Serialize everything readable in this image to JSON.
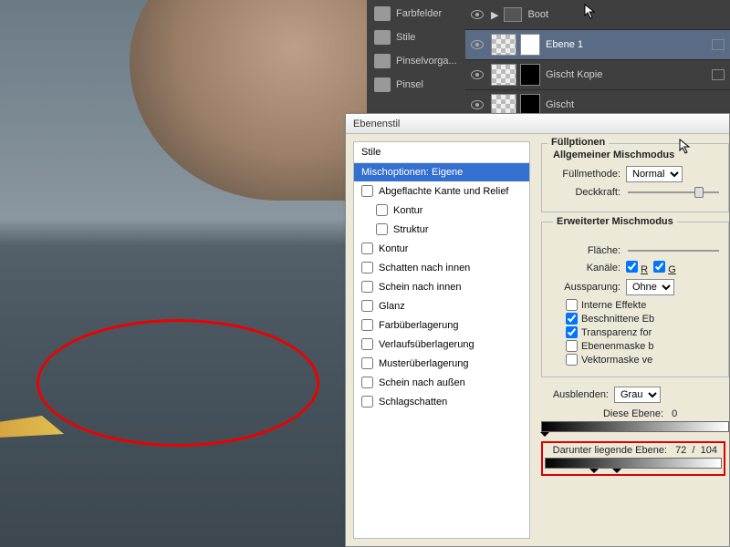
{
  "toolpanels": [
    "Farbfelder",
    "Stile",
    "Pinselvorga...",
    "Pinsel"
  ],
  "layers": [
    {
      "name": "Boot",
      "selected": false,
      "folder": true
    },
    {
      "name": "Ebene 1",
      "selected": true
    },
    {
      "name": "Gischt Kopie",
      "selected": false
    },
    {
      "name": "Gischt",
      "selected": false
    }
  ],
  "dialog": {
    "title": "Ebenenstil",
    "styles_header": "Stile",
    "styles": [
      {
        "label": "Mischoptionen: Eigene",
        "selected": true,
        "checkbox": false
      },
      {
        "label": "Abgeflachte Kante und Relief",
        "checkbox": true
      },
      {
        "label": "Kontur",
        "checkbox": true,
        "sub": true
      },
      {
        "label": "Struktur",
        "checkbox": true,
        "sub": true
      },
      {
        "label": "Kontur",
        "checkbox": true
      },
      {
        "label": "Schatten nach innen",
        "checkbox": true
      },
      {
        "label": "Schein nach innen",
        "checkbox": true
      },
      {
        "label": "Glanz",
        "checkbox": true
      },
      {
        "label": "Farbüberlagerung",
        "checkbox": true
      },
      {
        "label": "Verlaufsüberlagerung",
        "checkbox": true
      },
      {
        "label": "Musterüberlagerung",
        "checkbox": true
      },
      {
        "label": "Schein nach außen",
        "checkbox": true
      },
      {
        "label": "Schlagschatten",
        "checkbox": true
      }
    ],
    "fill": {
      "title": "Füllmethode:",
      "heading": "Allgemeiner Mischmodus",
      "group_heading": "Füllptionen",
      "value": "Normal",
      "opacity_label": "Deckkraft:"
    },
    "adv": {
      "heading": "Erweiterter Mischmodus",
      "area_label": "Fläche:",
      "channels_label": "Kanäle:",
      "channels": [
        "R",
        "G"
      ],
      "knockout_label": "Aussparung:",
      "knockout_value": "Ohne",
      "checks": [
        "Interne Effekte",
        "Beschnittene Eb",
        "Transparenz for",
        "Ebenenmaske b",
        "Vektormaske ve"
      ],
      "checked": [
        false,
        true,
        true,
        false,
        false
      ]
    },
    "blend": {
      "knockout_mode_label": "Ausblenden:",
      "knockout_mode_value": "Grau",
      "this_label": "Diese Ebene:",
      "this_low": "0",
      "under_label": "Darunter liegende Ebene:",
      "under_low": "72",
      "under_sep": "/",
      "under_high": "104"
    }
  }
}
